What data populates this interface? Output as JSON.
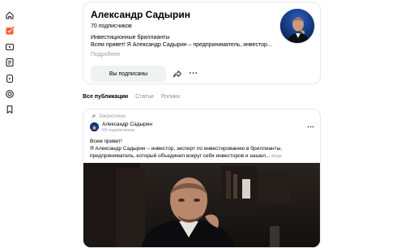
{
  "sidebar": {
    "items": [
      {
        "icon": "home-icon"
      },
      {
        "icon": "subscriptions-icon",
        "active": true
      },
      {
        "icon": "video-icon"
      },
      {
        "icon": "articles-icon"
      },
      {
        "icon": "shorts-icon"
      },
      {
        "icon": "channels-icon"
      },
      {
        "icon": "bookmark-icon"
      }
    ],
    "accent_color": "#ff5a2a"
  },
  "profile": {
    "name": "Александр Садырин",
    "subscribers": "70 подписчиков",
    "description_line1": "Инвестиционные бриллианты",
    "description_line2": "Всем привет! Я Александр Садырин – предприниматель, инвестор...",
    "more_label": "Подробнее",
    "subscribed_label": "Вы подписаны"
  },
  "tabs": [
    {
      "label": "Все публикации",
      "active": true
    },
    {
      "label": "Статьи",
      "active": false
    },
    {
      "label": "Ролики",
      "active": false
    }
  ],
  "post": {
    "pinned_label": "Закреплено",
    "author": "Александр Садырин",
    "author_subs": "69 подписчиков",
    "text_line1": "Всем привет!",
    "text_line2": "Я Александр Садырин – инвестор, эксперт по инвестированию в бриллианты,",
    "text_line3": "предприниматель, который объединил вокруг себя инвесторов и нашел...",
    "more_label": "еще"
  }
}
